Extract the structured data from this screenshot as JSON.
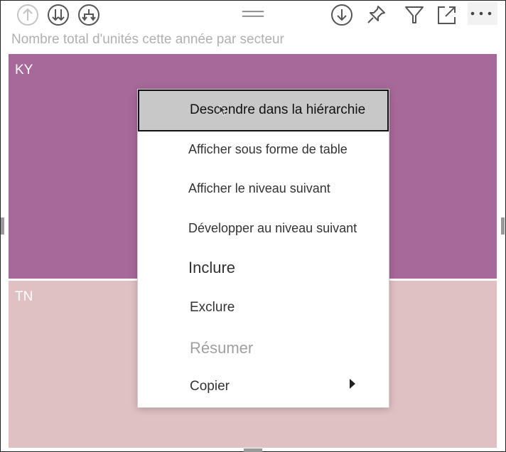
{
  "toolbar": {
    "icons": {
      "drill_up": "drill-up-icon",
      "next_level": "next-level-icon",
      "expand_next_level": "expand-next-level-icon",
      "drag_handle": "drag-handle-icon",
      "drill_down": "drill-down-icon",
      "pin": "pin-icon",
      "filter": "filter-icon",
      "focus_mode": "focus-mode-icon",
      "more_options": "more-options-icon"
    }
  },
  "visual": {
    "title": "Nombre total d'unités cette année par secteur",
    "tiles": [
      {
        "label": "KY",
        "color": "#a66999"
      },
      {
        "label": "TN",
        "color": "#dfc0c3"
      }
    ]
  },
  "context_menu": {
    "items": [
      {
        "label": "Descendre dans la hiérarchie",
        "state": "highlighted"
      },
      {
        "label": "Afficher sous forme de table",
        "state": "enabled"
      },
      {
        "label": "Afficher le niveau suivant",
        "state": "enabled"
      },
      {
        "label": "Développer au niveau suivant",
        "state": "enabled"
      },
      {
        "label": "Inclure",
        "state": "enabled"
      },
      {
        "label": "Exclure",
        "state": "enabled"
      },
      {
        "label": "Résumer",
        "state": "disabled"
      },
      {
        "label": "Copier",
        "state": "enabled",
        "submenu": true
      }
    ]
  }
}
